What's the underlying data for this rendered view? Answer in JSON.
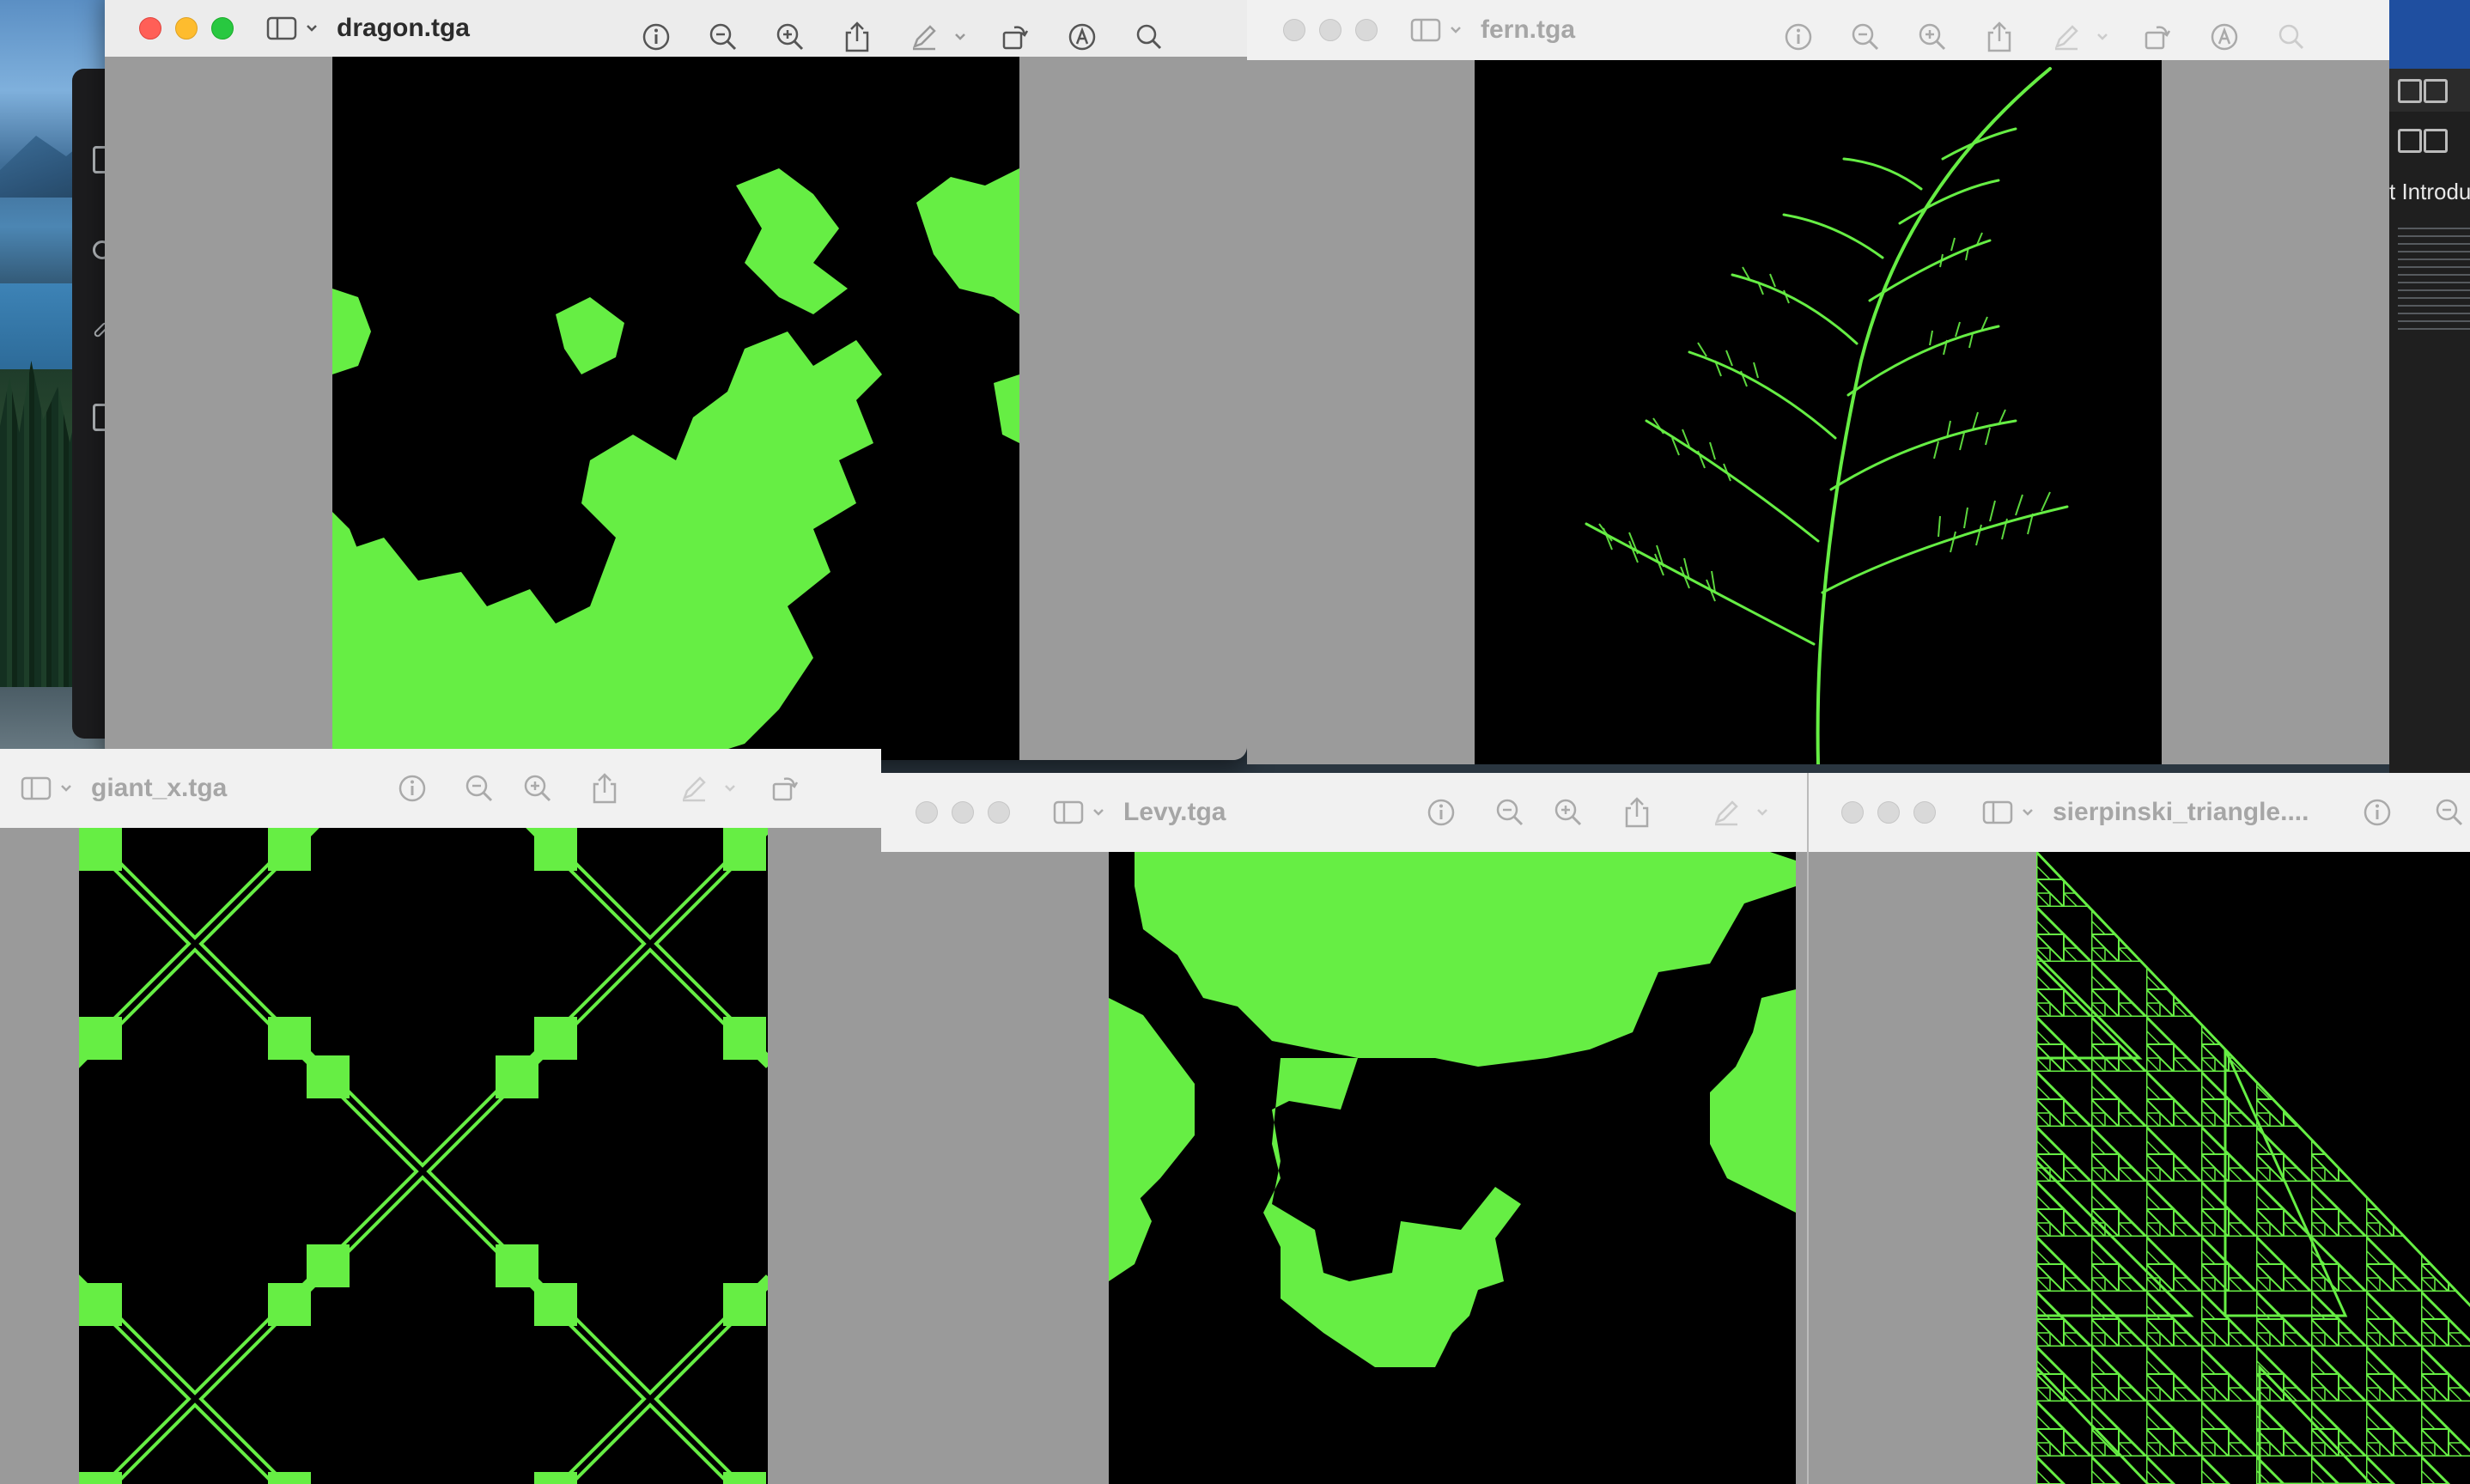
{
  "screen": {
    "background_color": "#2a3640",
    "fractal_color": "#66ee44"
  },
  "background_app": {
    "heading_partial": "t Introdu"
  },
  "windows": [
    {
      "id": "dragon",
      "title": "dragon.tga",
      "active": true,
      "fractal": "dragon curve"
    },
    {
      "id": "fern",
      "title": "fern.tga",
      "active": false,
      "fractal": "barnsley fern"
    },
    {
      "id": "giant_x",
      "title": "giant_x.tga",
      "active": false,
      "fractal": "giant x"
    },
    {
      "id": "levy",
      "title": "Levy.tga",
      "active": false,
      "fractal": "levy c curve"
    },
    {
      "id": "sierpinski",
      "title": "sierpinski_triangle....",
      "active": false,
      "fractal": "sierpinski triangle"
    }
  ],
  "toolbar_icons": [
    "info-icon",
    "zoom-out-icon",
    "zoom-in-icon",
    "share-icon",
    "markup-icon",
    "chevron-down-icon",
    "rotate-icon",
    "annotate-icon",
    "search-icon"
  ]
}
